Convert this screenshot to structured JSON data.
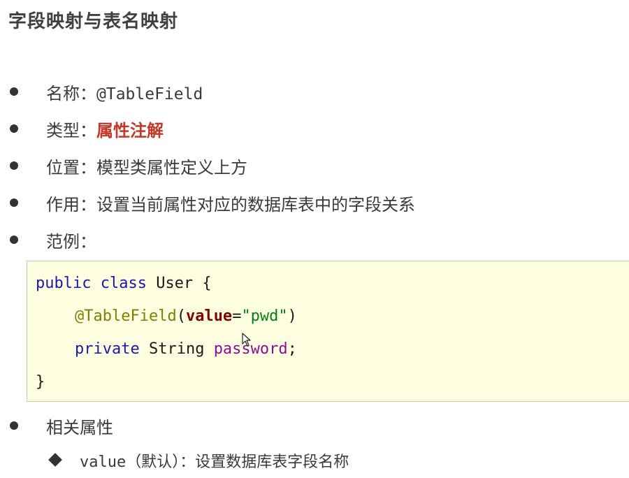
{
  "title": "字段映射与表名映射",
  "bullets": {
    "name_label": "名称：",
    "name_value": "@TableField",
    "type_label": "类型：",
    "type_value": "属性注解",
    "position_label": "位置：",
    "position_value": "模型类属性定义上方",
    "usage_label": "作用：",
    "usage_value": "设置当前属性对应的数据库表中的字段关系",
    "example_label": "范例：",
    "related_label": "相关属性"
  },
  "code": {
    "line1_kw": "public class",
    "line1_rest": " User {",
    "line2_ann": "@TableField",
    "line2_paren_open": "(",
    "line2_attr": "value",
    "line2_eq": "=",
    "line2_str": "\"pwd\"",
    "line2_paren_close": ")",
    "line3_kw": "private",
    "line3_type": " String ",
    "line3_field": "password",
    "line3_semi": ";",
    "line4": "}"
  },
  "sub_attribute": {
    "name": "value",
    "desc": "（默认）：设置数据库表字段名称"
  },
  "colors": {
    "keyword": "#1a1aa6",
    "annotation": "#808000",
    "attribute": "#7f0000",
    "string": "#067d17",
    "field": "#871094",
    "highlight_red": "#c0392b",
    "code_background": "#fdfde0"
  },
  "icons": {
    "bullet": "filled-circle",
    "sub_bullet": "filled-diamond",
    "cursor": "mouse-pointer-arrow"
  }
}
